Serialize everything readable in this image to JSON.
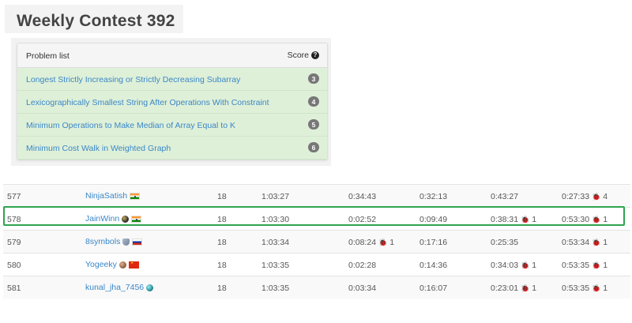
{
  "contest": {
    "title": "Weekly Contest 392"
  },
  "problem_panel": {
    "header": "Problem list",
    "score_label": "Score",
    "problems": [
      {
        "title": "Longest Strictly Increasing or Strictly Decreasing Subarray",
        "score": "3"
      },
      {
        "title": "Lexicographically Smallest String After Operations With Constraint",
        "score": "4"
      },
      {
        "title": "Minimum Operations to Make Median of Array Equal to K",
        "score": "5"
      },
      {
        "title": "Minimum Cost Walk in Weighted Graph",
        "score": "6"
      }
    ]
  },
  "ranking": {
    "rows": [
      {
        "rank": "577",
        "user": "NinjaSatish",
        "avatar": "none",
        "flag": "india",
        "score": "18",
        "finish": "1:03:27",
        "q1": "0:34:43",
        "q1_wa": "",
        "q2": "0:32:13",
        "q2_wa": "",
        "q3": "0:43:27",
        "q3_wa": "",
        "q4": "0:27:33",
        "q4_wa": "4"
      },
      {
        "rank": "578",
        "user": "JainWinn",
        "avatar": "dark-badge",
        "flag": "india",
        "score": "18",
        "finish": "1:03:30",
        "q1": "0:02:52",
        "q1_wa": "",
        "q2": "0:09:49",
        "q2_wa": "",
        "q3": "0:38:31",
        "q3_wa": "1",
        "q4": "0:53:30",
        "q4_wa": "1"
      },
      {
        "rank": "579",
        "user": "8symbols",
        "avatar": "shield-badge",
        "flag": "russia",
        "score": "18",
        "finish": "1:03:34",
        "q1": "0:08:24",
        "q1_wa": "1",
        "q2": "0:17:16",
        "q2_wa": "",
        "q3": "0:25:35",
        "q3_wa": "",
        "q4": "0:53:34",
        "q4_wa": "1"
      },
      {
        "rank": "580",
        "user": "Yogeeky",
        "avatar": "brown-badge",
        "flag": "china",
        "score": "18",
        "finish": "1:03:35",
        "q1": "0:02:28",
        "q1_wa": "",
        "q2": "0:14:36",
        "q2_wa": "",
        "q3": "0:34:03",
        "q3_wa": "1",
        "q4": "0:53:35",
        "q4_wa": "1"
      },
      {
        "rank": "581",
        "user": "kunal_jha_7456",
        "avatar": "teal-badge",
        "flag": "none",
        "score": "18",
        "finish": "1:03:35",
        "q1": "0:03:34",
        "q1_wa": "",
        "q2": "0:16:07",
        "q2_wa": "",
        "q3": "0:23:01",
        "q3_wa": "1",
        "q4": "0:53:35",
        "q4_wa": "1"
      }
    ]
  },
  "icons": {
    "help": "question-circle-icon",
    "wrong_answer": "bug-icon"
  },
  "colors": {
    "accent_link": "#3a87c8",
    "solved_row": "#dff0d8",
    "highlight": "#2ea44f",
    "bug": "#c9302c"
  }
}
